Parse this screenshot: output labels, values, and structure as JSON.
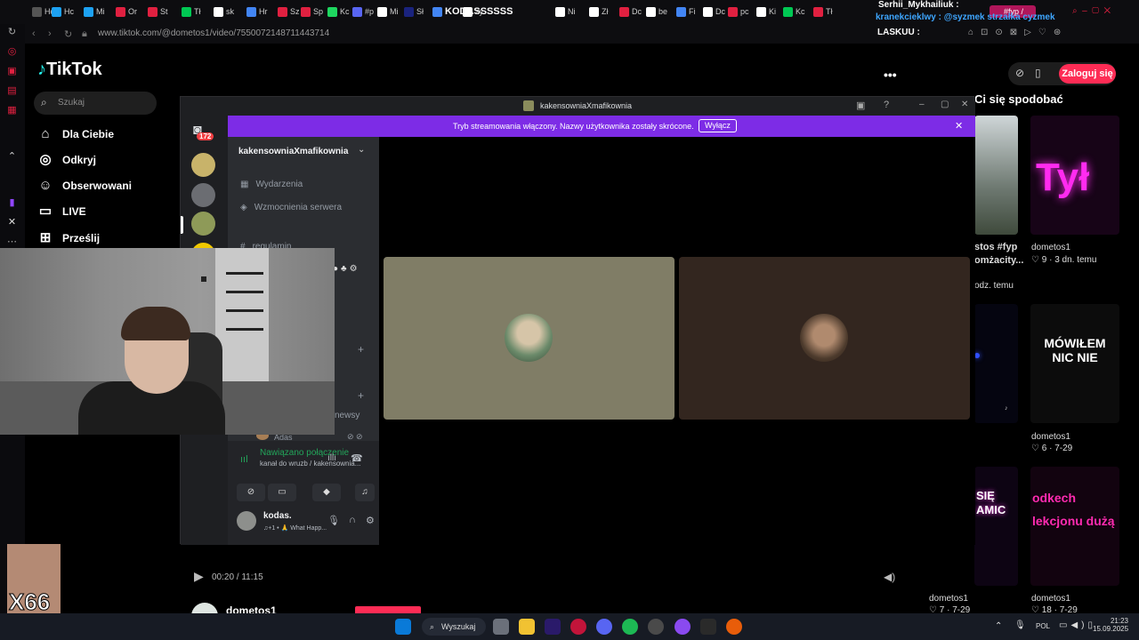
{
  "browser": {
    "tabs": [
      "Hc",
      "Hc",
      "Mi",
      "Or",
      "St",
      "Tł",
      "sk",
      "Hr",
      "Sz",
      "Sp",
      "Kc",
      "#p",
      "Mi",
      "Sł",
      "KODASSSSSS",
      "zy",
      "Ni",
      "Zł",
      "Dc",
      "be",
      "Fi",
      "Dc",
      "pc",
      "Ki",
      "Kc",
      "Tł",
      "#fyp /"
    ],
    "url": "www.tiktok.com/@dometos1/video/7550072148711443714",
    "overlay_user": "Serhii_Mykhailiuk :",
    "overlay_chat": "kranekcieklwy : @syzmek strzałka cyzmek",
    "overlay_chat2": "LASKUU :"
  },
  "tiktok": {
    "logo": "TikTok",
    "search_placeholder": "Szukaj",
    "nav": [
      "Dla Ciebie",
      "Odkryj",
      "Obserwowani",
      "LIVE",
      "Prześlij"
    ],
    "login": "Zaloguj się",
    "liked_header": "Ci się spodobać",
    "more": "•••",
    "cards": [
      {
        "caption1": "stos #fyp",
        "caption2": "omżacity...",
        "caption3": "odz. temu"
      },
      {
        "title": "Tył",
        "author": "dometos1",
        "meta": "♡ 9 · 3 dn. temu"
      },
      {
        "title": "MÓWIŁEM NIC NIE",
        "author": "dometos1",
        "meta": "♡ 6 · 7-29"
      },
      {
        "title": "SIĘ AMIC",
        "author": "dometos1",
        "meta": "♡ 7 · 7-29"
      },
      {
        "title": "odkech lekcjonu dużą",
        "author": "dometos1",
        "meta": "♡ 18 · 7-29"
      }
    ],
    "player_time": "00:20 / 11:15",
    "channel_author": "dometos1"
  },
  "discord": {
    "window_title": "kakensowniaXmafikownia",
    "banner_text": "Tryb streamowania włączony. Nazwy użytkownika zostały skrócone.",
    "banner_button": "Wyłącz",
    "badge": "172",
    "server_name": "kakensowniaXmafikownia",
    "channels": [
      "Wydarzenia",
      "Wzmocnienia serwera",
      "regulamin"
    ],
    "partial_channel": "newsy",
    "voice_member": "Adas",
    "connection_status": "Nawiązano połączenie",
    "connection_sub": "kanał do wruzb / kakensownia...",
    "user_name": "kodas.",
    "user_status": "♫+1 • 🙏 What Happ..."
  },
  "overlay": {
    "badge": "X66"
  },
  "taskbar": {
    "search": "Wyszukaj",
    "lang": "POL",
    "time": "21:23",
    "date": "15.09.2025"
  },
  "colors": {
    "tiktok_red": "#fe2c55",
    "discord_purple": "#7d2ce6",
    "opera_red": "#e02040"
  }
}
